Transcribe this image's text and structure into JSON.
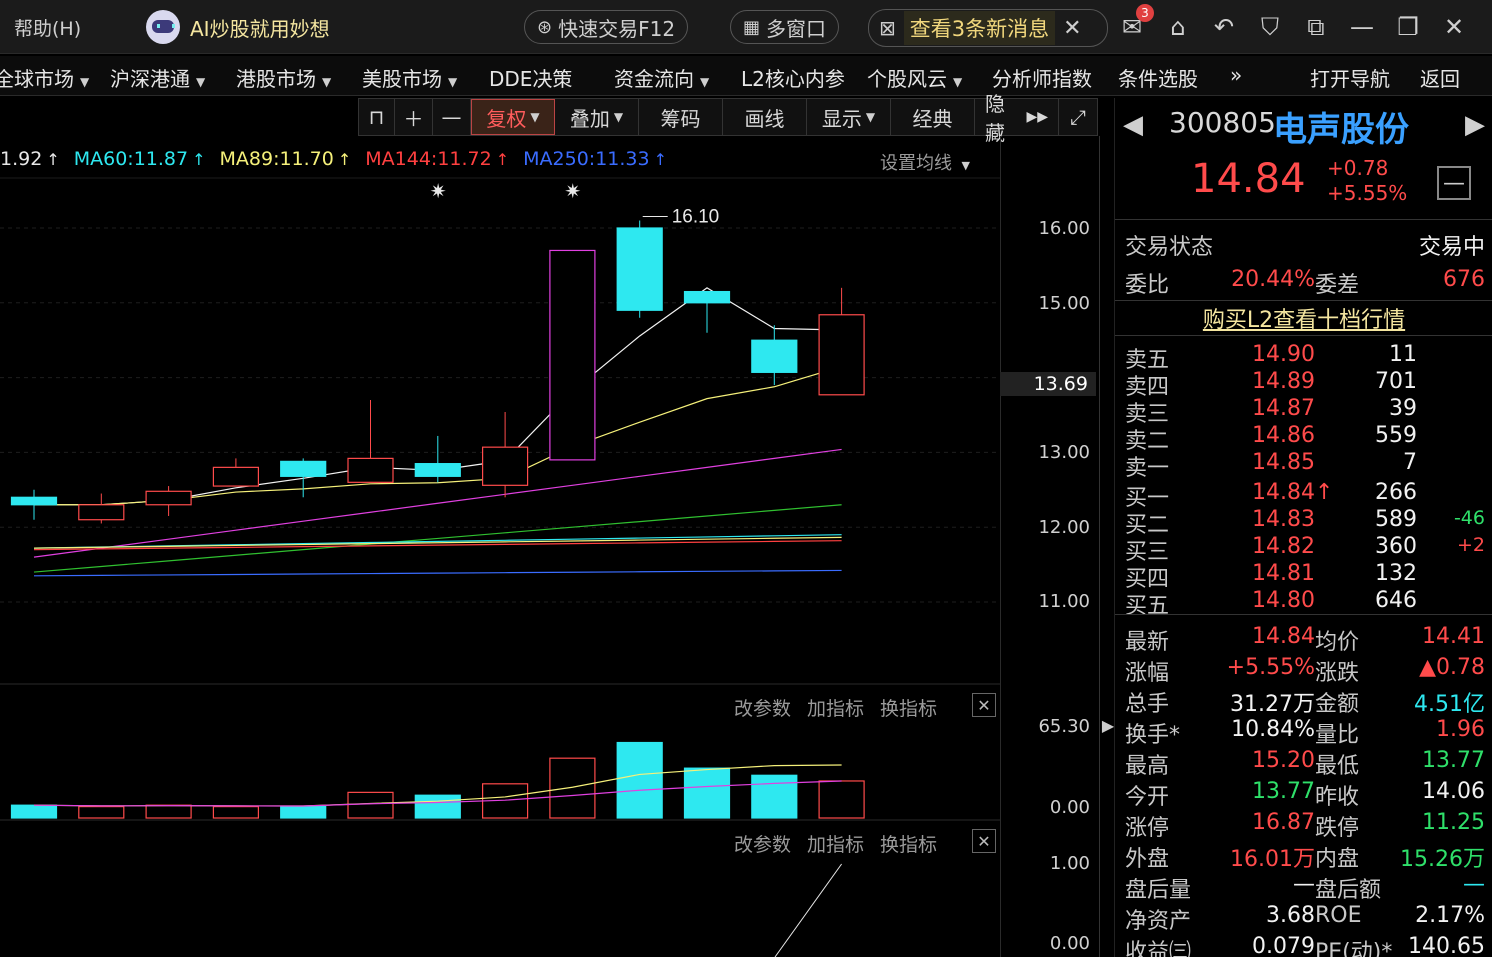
{
  "titlebar": {
    "help": "帮助(H)",
    "ai_label": "AI炒股就用妙想",
    "quick_trade": "快速交易F12",
    "multi_window": "多窗口",
    "new_messages": "查看3条新消息",
    "mail_badge": "3"
  },
  "menu": [
    {
      "label": "全球市场",
      "caret": true
    },
    {
      "label": "沪深港通",
      "caret": true
    },
    {
      "label": "港股市场",
      "caret": true
    },
    {
      "label": "美股市场",
      "caret": true
    },
    {
      "label": "DDE决策",
      "caret": false
    },
    {
      "label": "资金流向",
      "caret": true
    },
    {
      "label": "L2核心内参",
      "caret": false
    },
    {
      "label": "个股风云",
      "caret": true
    },
    {
      "label": "分析师指数",
      "caret": false
    },
    {
      "label": "条件选股",
      "caret": false
    },
    {
      "label": "»",
      "caret": false
    },
    {
      "label": "打开导航",
      "caret": false
    },
    {
      "label": "返回",
      "caret": false
    }
  ],
  "toolbar": {
    "restore": "复权",
    "overlay": "叠加",
    "chips": "筹码",
    "draw": "画线",
    "display": "显示",
    "classic": "经典",
    "hide": "隐藏"
  },
  "ma_legend": [
    {
      "label": "1.92",
      "color": "#e8e8e8"
    },
    {
      "label": "MA60:11.87",
      "color": "#2ee8f0"
    },
    {
      "label": "MA89:11.70",
      "color": "#f5f07a"
    },
    {
      "label": "MA144:11.72",
      "color": "#ff4040"
    },
    {
      "label": "MA250:11.33",
      "color": "#3a6cff"
    }
  ],
  "set_ma": "设置均线",
  "y_axis": {
    "main": [
      "16.00",
      "15.00",
      "13.00",
      "12.00",
      "11.00"
    ],
    "current": "13.69",
    "volume": [
      "65.30",
      "0.00"
    ],
    "indicator": [
      "1.00",
      "0.00"
    ]
  },
  "sub_tools": {
    "change_param": "改参数",
    "add_indicator": "加指标",
    "switch_indicator": "换指标"
  },
  "high_label": "16.10",
  "chart_data": {
    "type": "candlestick",
    "candles": [
      {
        "open": 12.4,
        "close": 12.3,
        "high": 12.5,
        "low": 12.1
      },
      {
        "open": 12.1,
        "close": 12.3,
        "high": 12.45,
        "low": 12.05
      },
      {
        "open": 12.3,
        "close": 12.48,
        "high": 12.55,
        "low": 12.15
      },
      {
        "open": 12.55,
        "close": 12.8,
        "high": 12.92,
        "low": 12.55
      },
      {
        "open": 12.88,
        "close": 12.68,
        "high": 12.92,
        "low": 12.4
      },
      {
        "open": 12.6,
        "close": 12.92,
        "high": 13.7,
        "low": 12.6
      },
      {
        "open": 12.85,
        "close": 12.68,
        "high": 13.22,
        "low": 12.6
      },
      {
        "open": 12.56,
        "close": 13.07,
        "high": 13.54,
        "low": 12.4
      },
      {
        "open": 12.9,
        "close": 15.7,
        "high": 15.7,
        "low": 12.9
      },
      {
        "open": 16.0,
        "close": 14.9,
        "high": 16.1,
        "low": 14.8
      },
      {
        "open": 15.15,
        "close": 15.0,
        "high": 15.15,
        "low": 14.6
      },
      {
        "open": 14.5,
        "close": 14.07,
        "high": 14.7,
        "low": 13.9
      },
      {
        "open": 13.77,
        "close": 14.84,
        "high": 15.2,
        "low": 13.77
      }
    ],
    "volumes": [
      9,
      8,
      9,
      8,
      8,
      18,
      16,
      24,
      42,
      53,
      35,
      30,
      26
    ],
    "ylim": [
      10.0,
      16.5
    ],
    "vol_max": 65.3
  },
  "quote": {
    "code": "300805",
    "name": "电声股份",
    "price": "14.84",
    "change": "+0.78",
    "change_pct": "+5.55%",
    "status_label": "交易状态",
    "status_value": "交易中",
    "ratio_label": "委比",
    "ratio_value": "20.44%",
    "diff_label": "委差",
    "diff_value": "676",
    "l2_buy": "购买L2查看十档行情",
    "asks": [
      {
        "label": "卖五",
        "price": "14.90",
        "vol": "11",
        "chg": ""
      },
      {
        "label": "卖四",
        "price": "14.89",
        "vol": "701",
        "chg": ""
      },
      {
        "label": "卖三",
        "price": "14.87",
        "vol": "39",
        "chg": ""
      },
      {
        "label": "卖二",
        "price": "14.86",
        "vol": "559",
        "chg": ""
      },
      {
        "label": "卖一",
        "price": "14.85",
        "vol": "7",
        "chg": ""
      }
    ],
    "bids": [
      {
        "label": "买一",
        "price": "14.84",
        "arrow": "↑",
        "vol": "266",
        "chg": ""
      },
      {
        "label": "买二",
        "price": "14.83",
        "arrow": "",
        "vol": "589",
        "chg": "-46"
      },
      {
        "label": "买三",
        "price": "14.82",
        "arrow": "",
        "vol": "360",
        "chg": "+2"
      },
      {
        "label": "买四",
        "price": "14.81",
        "arrow": "",
        "vol": "132",
        "chg": ""
      },
      {
        "label": "买五",
        "price": "14.80",
        "arrow": "",
        "vol": "646",
        "chg": ""
      }
    ],
    "stats": [
      {
        "l1": "最新",
        "v1": "14.84",
        "c1": "red",
        "l2": "均价",
        "v2": "14.41",
        "c2": "red"
      },
      {
        "l1": "涨幅",
        "v1": "+5.55%",
        "c1": "red",
        "l2": "涨跌",
        "v2": "▲0.78",
        "c2": "red"
      },
      {
        "l1": "总手",
        "v1": "31.27万",
        "c1": "white",
        "l2": "金额",
        "v2": "4.51亿",
        "c2": "cyan"
      },
      {
        "l1": "换手*",
        "v1": "10.84%",
        "c1": "white",
        "l2": "量比",
        "v2": "1.96",
        "c2": "red"
      },
      {
        "l1": "最高",
        "v1": "15.20",
        "c1": "red",
        "l2": "最低",
        "v2": "13.77",
        "c2": "green"
      },
      {
        "l1": "今开",
        "v1": "13.77",
        "c1": "green",
        "l2": "昨收",
        "v2": "14.06",
        "c2": "white"
      },
      {
        "l1": "涨停",
        "v1": "16.87",
        "c1": "red",
        "l2": "跌停",
        "v2": "11.25",
        "c2": "green"
      },
      {
        "l1": "外盘",
        "v1": "16.01万",
        "c1": "red",
        "l2": "内盘",
        "v2": "15.26万",
        "c2": "green"
      },
      {
        "l1": "盘后量",
        "v1": "—",
        "c1": "white",
        "l2": "盘后额",
        "v2": "—",
        "c2": "cyan"
      },
      {
        "l1": "净资产",
        "v1": "3.68",
        "c1": "white",
        "l2": "ROE",
        "v2": "2.17%",
        "c2": "white"
      },
      {
        "l1": "收益㈢",
        "v1": "0.079",
        "c1": "white",
        "l2": "PE(动)*",
        "v2": "140.65",
        "c2": "white"
      }
    ]
  }
}
